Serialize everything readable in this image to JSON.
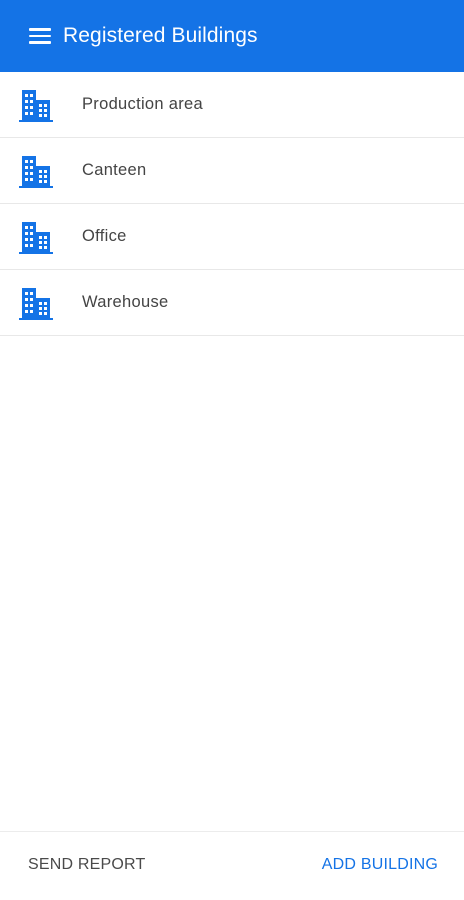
{
  "app_bar": {
    "title": "Registered Buildings",
    "background_color": "#1473e6",
    "menu_icon": "hamburger-menu-icon"
  },
  "buildings": [
    {
      "label": "Production area",
      "icon": "building-icon"
    },
    {
      "label": "Canteen",
      "icon": "building-icon"
    },
    {
      "label": "Office",
      "icon": "building-icon"
    },
    {
      "label": "Warehouse",
      "icon": "building-icon"
    }
  ],
  "footer": {
    "send_report_label": "SEND REPORT",
    "add_building_label": "ADD BUILDING",
    "accent_color": "#1473e6"
  }
}
